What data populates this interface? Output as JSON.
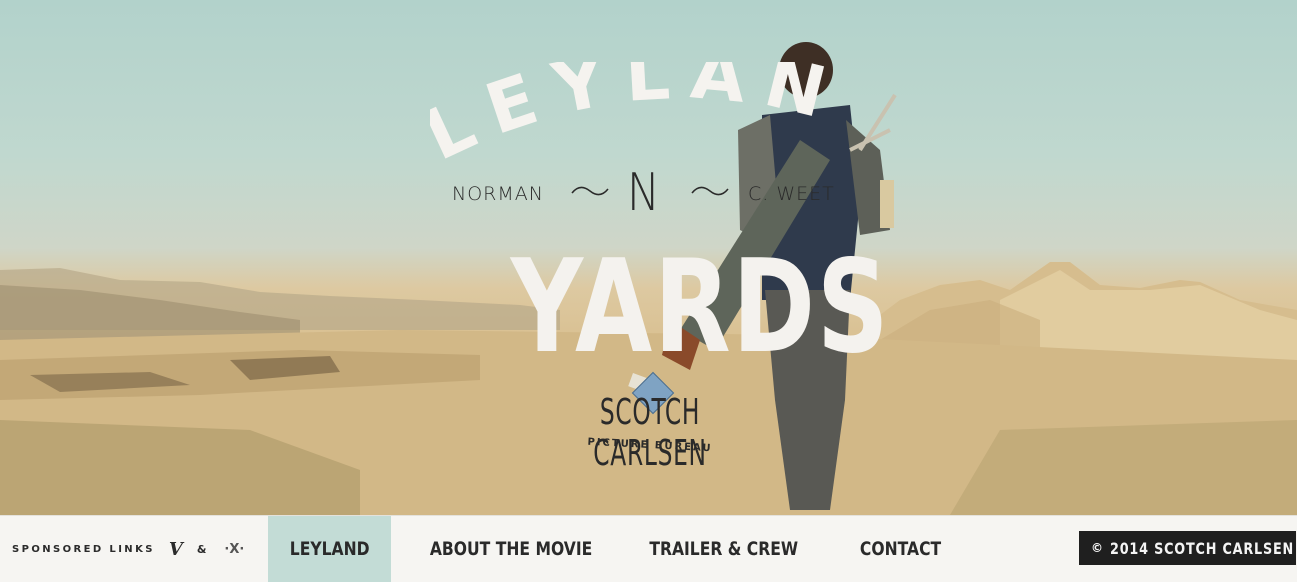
{
  "hero": {
    "title_top": "LEYLAND",
    "subtitle_left": "NORMAN",
    "subtitle_center_mark": "N",
    "subtitle_right": "C. WEET",
    "title_bottom": "YARDS",
    "studio_name": "SCOTCH CARLSEN",
    "studio_sub": "PICTURE BUREAU"
  },
  "footer": {
    "sponsored_label": "SPONSORED LINKS",
    "vimeo_glyph": "V",
    "amp": "&",
    "partner_glyph": "·X·",
    "nav": [
      {
        "label": "LEYLAND",
        "active": true
      },
      {
        "label": "ABOUT THE MOVIE",
        "active": false
      },
      {
        "label": "TRAILER & CREW",
        "active": false
      },
      {
        "label": "CONTACT",
        "active": false
      }
    ],
    "copyright": "2014 SCOTCH CARLSEN",
    "copyright_icon": "©"
  },
  "colors": {
    "sky": "#b2d2cb",
    "sand": "#d8bd8c",
    "nav_active": "#c3dcd6",
    "copyright_bg": "#1f1f1f"
  }
}
